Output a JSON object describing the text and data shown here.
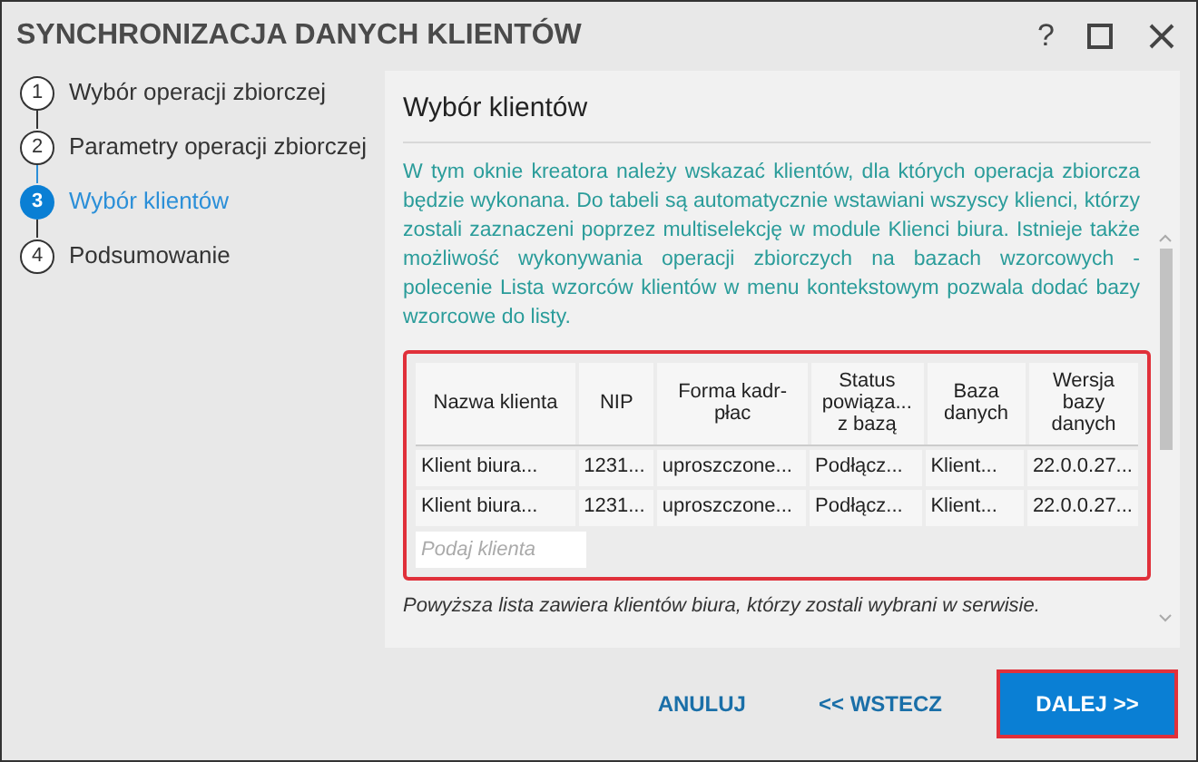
{
  "window": {
    "title": "SYNCHRONIZACJA DANYCH KLIENTÓW",
    "controls": [
      "?"
    ]
  },
  "steps": [
    {
      "number": "1",
      "label": "Wybór operacji zbiorczej",
      "selected": false
    },
    {
      "number": "2",
      "label": "Parametry operacji zbiorczej",
      "selected": false
    },
    {
      "number": "3",
      "label": "Wybór klientów",
      "selected": true
    },
    {
      "number": "4",
      "label": "Podsumowanie",
      "selected": false
    }
  ],
  "panel": {
    "heading": "Wybór klientów",
    "description": "W tym oknie kreatora należy wskazać klientów, dla których operacja zbiorcza będzie wykonana. Do tabeli są automatycznie wstawiani wszyscy klienci, którzy zostali zaznaczeni poprzez multiselekcję w module Klienci biura. Istnieje także możliwość wykonywania operacji zbiorczych na bazach wzorcowych - polecenie Lista wzorców klientów w menu kontekstowym pozwala dodać bazy wzorcowe do listy.",
    "note": "Powyższa lista zawiera klientów biura, którzy zostali wybrani w serwisie."
  },
  "table": {
    "highlighted": true,
    "columns": [
      "Nazwa klienta",
      "NIP",
      "Forma kadr-płac",
      "Status powiąza... z bazą",
      "Baza danych",
      "Wersja bazy danych"
    ],
    "rows": [
      [
        "Klient biura...",
        "1231...",
        "uproszczone...",
        "Podłącz...",
        "Klient...",
        "22.0.0.27..."
      ],
      [
        "Klient biura...",
        "1231...",
        "uproszczone...",
        "Podłącz...",
        "Klient...",
        "22.0.0.27..."
      ]
    ],
    "input": {
      "placeholder": "Podaj klienta"
    }
  },
  "buttons": [
    {
      "label": "ANULUJ",
      "kind": "link",
      "highlighted": false
    },
    {
      "label": "<< WSTECZ",
      "kind": "link",
      "highlighted": false
    },
    {
      "label": "DALEJ >>",
      "kind": "primary",
      "highlighted": true
    }
  ]
}
